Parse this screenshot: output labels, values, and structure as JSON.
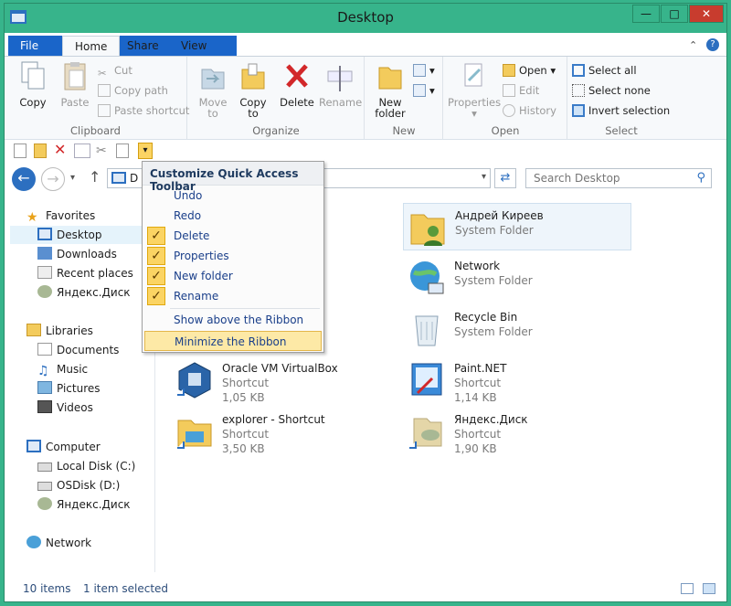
{
  "window": {
    "title": "Desktop"
  },
  "tabs": {
    "file": "File",
    "home": "Home",
    "share": "Share",
    "view": "View"
  },
  "ribbon": {
    "clipboard": {
      "label": "Clipboard",
      "copy": "Copy",
      "paste": "Paste",
      "cut": "Cut",
      "copy_path": "Copy path",
      "paste_shortcut": "Paste shortcut"
    },
    "organize": {
      "label": "Organize",
      "move_to": "Move",
      "move_to_2": "to",
      "copy_to": "Copy",
      "copy_to_2": "to",
      "delete": "Delete",
      "rename": "Rename"
    },
    "new": {
      "label": "New",
      "new_folder": "New",
      "new_folder_2": "folder"
    },
    "open": {
      "label": "Open",
      "properties": "Properties",
      "open": "Open",
      "edit": "Edit",
      "history": "History"
    },
    "select": {
      "label": "Select",
      "select_all": "Select all",
      "select_none": "Select none",
      "invert": "Invert selection"
    }
  },
  "address": {
    "path": "D",
    "search_placeholder": "Search Desktop"
  },
  "menu": {
    "title": "Customize Quick Access Toolbar",
    "items": [
      {
        "label": "Undo",
        "checked": false
      },
      {
        "label": "Redo",
        "checked": false
      },
      {
        "label": "Delete",
        "checked": true
      },
      {
        "label": "Properties",
        "checked": true
      },
      {
        "label": "New folder",
        "checked": true
      },
      {
        "label": "Rename",
        "checked": true
      }
    ],
    "show_above": "Show above the Ribbon",
    "minimize": "Minimize the Ribbon"
  },
  "nav": {
    "favorites": "Favorites",
    "desktop": "Desktop",
    "downloads": "Downloads",
    "recent": "Recent places",
    "yadisk": "Яндекс.Диск",
    "libraries": "Libraries",
    "documents": "Documents",
    "music": "Music",
    "pictures": "Pictures",
    "videos": "Videos",
    "computer": "Computer",
    "local_disk": "Local Disk (C:)",
    "osdisk": "OSDisk (D:)",
    "yadisk2": "Яндекс.Диск",
    "network": "Network"
  },
  "files": [
    {
      "name": "Андрей Киреев",
      "type": "System Folder",
      "size": ""
    },
    {
      "name": "Network",
      "type": "System Folder",
      "size": ""
    },
    {
      "name": "Recycle Bin",
      "type": "System Folder",
      "size": ""
    },
    {
      "name": "Oracle VM VirtualBox",
      "type": "Shortcut",
      "size": "1,05 KB"
    },
    {
      "name": "Paint.NET",
      "type": "Shortcut",
      "size": "1,14 KB"
    },
    {
      "name": "explorer - Shortcut",
      "type": "Shortcut",
      "size": "3,50 KB"
    },
    {
      "name": "Яндекс.Диск",
      "type": "Shortcut",
      "size": "1,90 KB"
    }
  ],
  "status": {
    "items": "10 items",
    "selected": "1 item selected"
  }
}
